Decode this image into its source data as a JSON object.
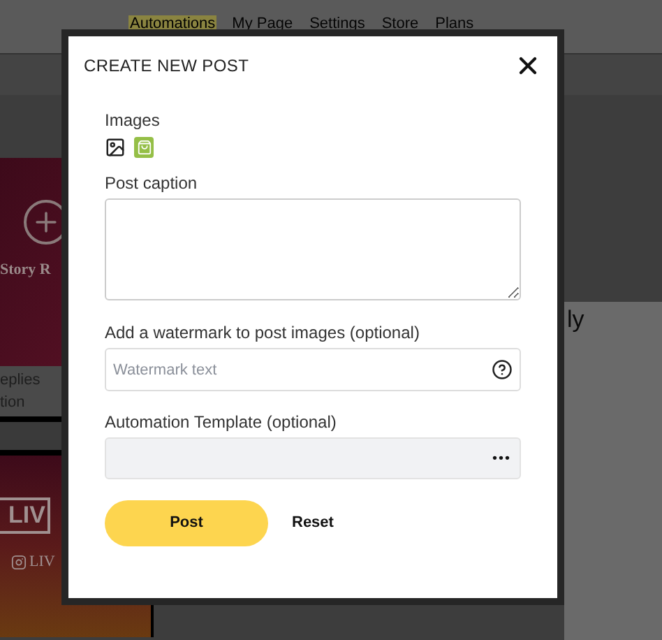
{
  "nav": {
    "items": [
      {
        "label": "Automations",
        "selected": true
      },
      {
        "label": "My Page",
        "selected": false
      },
      {
        "label": "Settings",
        "selected": false
      },
      {
        "label": "Store",
        "selected": false
      },
      {
        "label": "Plans",
        "selected": false
      }
    ]
  },
  "background": {
    "story_card": {
      "title": "Story R"
    },
    "settings_rows": [
      "eplies",
      "tion"
    ],
    "live_card": {
      "title": "LIV",
      "handle": "LIV"
    },
    "heading_fragment": "ly"
  },
  "dialog": {
    "title": "CREATE NEW POST",
    "images_label": "Images",
    "caption_label": "Post caption",
    "watermark_label": "Add a watermark to post images (optional)",
    "watermark_field": {
      "placeholder": "Watermark text"
    },
    "template_label": "Automation Template (optional)",
    "template_menu": "•••",
    "buttons": [
      {
        "label": "Post",
        "kind": "primary"
      },
      {
        "label": "Reset",
        "kind": "plain"
      }
    ]
  }
}
